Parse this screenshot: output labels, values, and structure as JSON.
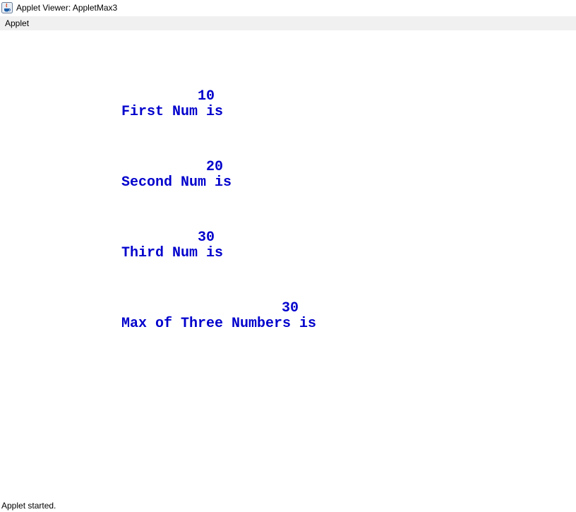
{
  "window": {
    "title": "Applet Viewer: AppletMax3",
    "icon": "java-cup-icon"
  },
  "menubar": {
    "items": [
      {
        "label": "Applet"
      }
    ]
  },
  "applet": {
    "text_color": "#0000cc",
    "lines": [
      {
        "label": "First Num is",
        "value": "10"
      },
      {
        "label": "Second Num is",
        "value": "20"
      },
      {
        "label": "Third Num is",
        "value": "30"
      },
      {
        "label": "Max of Three Numbers is",
        "value": "30"
      }
    ]
  },
  "status": {
    "text": "Applet started."
  }
}
